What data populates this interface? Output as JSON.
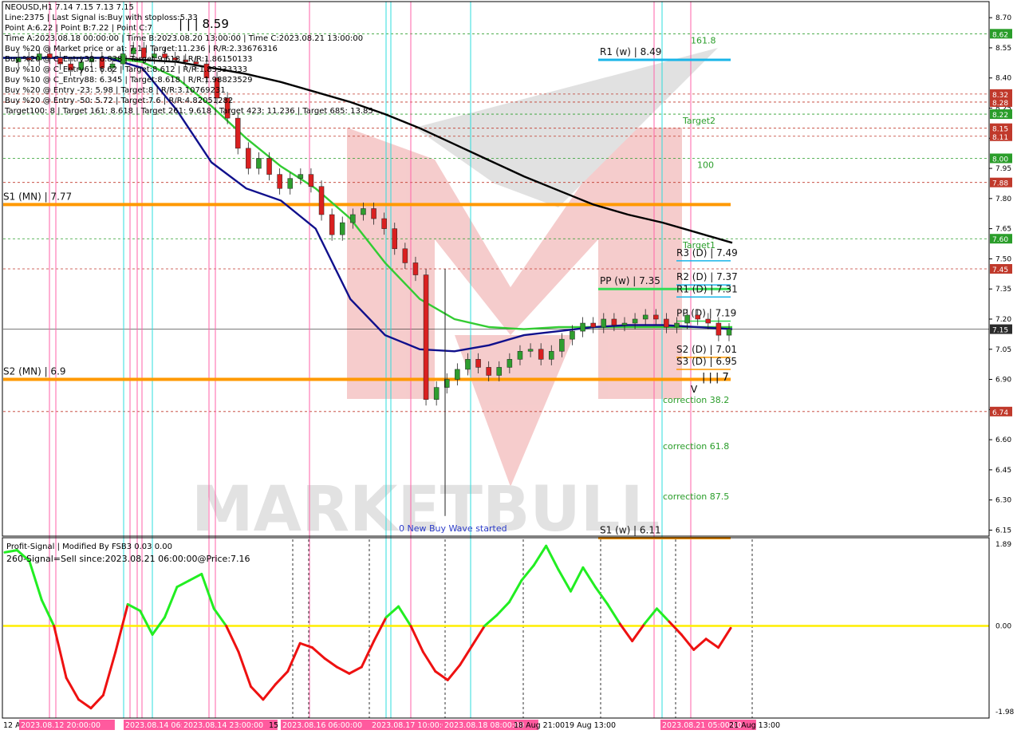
{
  "header": {
    "symbol_line": "NEOUSD,H1  7.14 7.15 7.13 7.15",
    "lines": [
      "Line:2375 | Last Signal is:Buy with stoploss:5.33",
      "Point A:6.22 | Point B:7.22 | Point C:7",
      "Time A:2023.08.18 00:00:00 | Time B:2023.08.20 13:00:00 | Time C:2023.08.21 13:00:00",
      "Buy %20 @ Market price or at: 7.1 | Target:11.236 | R/R:2.33676316",
      "Buy %20 @ C_Entry38: 6.838 | Target:9.618 | R/R:1.86150133",
      "Buy %10 @ C_Entry61: 6.62 | Target:8.612 | R/R:1.83333333",
      "Buy %10 @ C_Entry88: 6.345 | Target:8.618 | R/R:1.98823529",
      "Buy %20 @ Entry -23: 5.98 | Target:8 | R/R:3.10769231",
      "Buy %20 @ Entry -50: 5.72 | Target:7.6 | R/R:4.82051282",
      "Target100: 8 | Target 161: 8.618 | Target 261: 9.618 | Target 423: 11.236 | Target 685: 13.85"
    ],
    "wave_label": "| | | 8.59"
  },
  "chart_data": [
    {
      "type": "candlestick",
      "symbol": "NEOUSD",
      "timeframe": "H1",
      "ylim": [
        6.12,
        8.78
      ],
      "y_ticks": [
        "8.70",
        "8.55",
        "8.40",
        "8.25",
        "8.10",
        "7.95",
        "7.80",
        "7.65",
        "7.50",
        "7.35",
        "7.20",
        "7.05",
        "6.90",
        "6.75",
        "6.60",
        "6.45",
        "6.30",
        "6.15"
      ],
      "price_tags": [
        {
          "label": "8.62",
          "value": 8.62,
          "color": "#2a9d2a"
        },
        {
          "label": "8.32",
          "value": 8.32,
          "color": "#c0392b"
        },
        {
          "label": "8.28",
          "value": 8.28,
          "color": "#c0392b"
        },
        {
          "label": "8.22",
          "value": 8.22,
          "color": "#2a9d2a"
        },
        {
          "label": "8.15",
          "value": 8.15,
          "color": "#c0392b"
        },
        {
          "label": "8.11",
          "value": 8.11,
          "color": "#c0392b"
        },
        {
          "label": "8.00",
          "value": 8.0,
          "color": "#2a9d2a"
        },
        {
          "label": "7.88",
          "value": 7.88,
          "color": "#c0392b"
        },
        {
          "label": "7.60",
          "value": 7.6,
          "color": "#2a9d2a"
        },
        {
          "label": "7.45",
          "value": 7.45,
          "color": "#c0392b"
        },
        {
          "label": "7.15",
          "value": 7.15,
          "color": "#2b2b2b"
        },
        {
          "label": "6.74",
          "value": 6.74,
          "color": "#c0392b"
        }
      ],
      "levels": [
        {
          "label": "S1 (MN) | 7.77",
          "value": 7.77,
          "color": "#ff9900"
        },
        {
          "label": "S2 (MN) | 6.9",
          "value": 6.9,
          "color": "#ff9900"
        },
        {
          "label": "R1 (w) | 8.49",
          "value": 8.49,
          "color": "#19b5e8"
        },
        {
          "label": "PP (w) | 7.35",
          "value": 7.35,
          "color": "#33dd55"
        },
        {
          "label": "S1 (w) | 6.11",
          "value": 6.11,
          "color": "#ff9900"
        },
        {
          "label": "R3 (D) | 7.49",
          "value": 7.49,
          "color": "#19b5e8"
        },
        {
          "label": "R2 (D) | 7.37",
          "value": 7.37,
          "color": "#19b5e8"
        },
        {
          "label": "R1 (D) | 7.31",
          "value": 7.31,
          "color": "#19b5e8"
        },
        {
          "label": "PP (D) | 7.19",
          "value": 7.19,
          "color": "#33dd55"
        },
        {
          "label": "S2 (D) | 7.01",
          "value": 7.01,
          "color": "#ff9900"
        },
        {
          "label": "S3 (D) | 6.95",
          "value": 6.95,
          "color": "#ff9900"
        }
      ],
      "fib_labels": [
        {
          "label": "161.8",
          "value": 8.62,
          "color": "#2a9d2a"
        },
        {
          "label": "Target2",
          "value": 8.22,
          "color": "#2a9d2a"
        },
        {
          "label": "100",
          "value": 8.0,
          "color": "#2a9d2a"
        },
        {
          "label": "Target1",
          "value": 7.6,
          "color": "#2a9d2a"
        },
        {
          "label": "correction 38.2",
          "value": 6.83,
          "color": "#2a9d2a"
        },
        {
          "label": "correction 61.8",
          "value": 6.6,
          "color": "#2a9d2a"
        },
        {
          "label": "correction 87.5",
          "value": 6.35,
          "color": "#2a9d2a"
        }
      ],
      "annotations": [
        "0 New Buy Wave started",
        "| | | 7",
        "V"
      ],
      "moving_averages": [
        {
          "color": "#000000",
          "values": [
            8.5,
            8.5,
            8.5,
            8.5,
            8.49,
            8.48,
            8.45,
            8.42,
            8.38,
            8.33,
            8.28,
            8.22,
            8.15,
            8.07,
            7.99,
            7.91,
            7.84,
            7.77,
            7.72,
            7.68,
            7.63,
            7.58
          ]
        },
        {
          "color": "#33cc33",
          "values": [
            8.5,
            8.5,
            8.5,
            8.5,
            8.48,
            8.4,
            8.26,
            8.1,
            7.96,
            7.85,
            7.7,
            7.48,
            7.3,
            7.2,
            7.16,
            7.15,
            7.16,
            7.16,
            7.16,
            7.16,
            7.16,
            7.16
          ]
        },
        {
          "color": "#10108c",
          "values": [
            8.5,
            8.5,
            8.5,
            8.5,
            8.45,
            8.24,
            7.98,
            7.85,
            7.79,
            7.65,
            7.3,
            7.12,
            7.05,
            7.04,
            7.07,
            7.12,
            7.14,
            7.16,
            7.17,
            7.17,
            7.16,
            7.15
          ]
        }
      ],
      "price_path": [
        8.48,
        8.5,
        8.49,
        8.52,
        8.5,
        8.47,
        8.44,
        8.48,
        8.5,
        8.45,
        8.47,
        8.52,
        8.55,
        8.5,
        8.52,
        8.5,
        8.49,
        8.48,
        8.47,
        8.4,
        8.3,
        8.2,
        8.05,
        7.95,
        8.0,
        7.92,
        7.85,
        7.9,
        7.92,
        7.86,
        7.72,
        7.62,
        7.68,
        7.72,
        7.75,
        7.7,
        7.65,
        7.55,
        7.48,
        7.42,
        6.8,
        6.86,
        6.9,
        6.95,
        7.0,
        6.96,
        6.92,
        6.96,
        7.0,
        7.04,
        7.05,
        7.0,
        7.04,
        7.1,
        7.14,
        7.18,
        7.16,
        7.2,
        7.17,
        7.18,
        7.2,
        7.22,
        7.2,
        7.16,
        7.18,
        7.22,
        7.2,
        7.18,
        7.12,
        7.15
      ]
    },
    {
      "type": "line",
      "title": "Profit-Signal | Modified By FSB3 0.03 0.00",
      "subtitle": "260-Signal=Sell since:2023.08.21 06:00:00@Price:7.16",
      "ylim": [
        -1.98,
        1.89
      ],
      "y_ticks": [
        "1.89",
        "0.00",
        "-1.98"
      ],
      "values": [
        1.7,
        1.75,
        1.5,
        0.6,
        0.0,
        -1.2,
        -1.7,
        -1.9,
        -1.6,
        -0.6,
        0.5,
        0.35,
        -0.2,
        0.2,
        0.9,
        1.05,
        1.2,
        0.4,
        0.0,
        -0.6,
        -1.4,
        -1.7,
        -1.35,
        -1.05,
        -0.4,
        -0.5,
        -0.75,
        -0.95,
        -1.1,
        -0.95,
        -0.35,
        0.2,
        0.45,
        0.0,
        -0.6,
        -1.05,
        -1.25,
        -0.9,
        -0.45,
        0.0,
        0.25,
        0.55,
        1.05,
        1.4,
        1.85,
        1.3,
        0.8,
        1.35,
        0.9,
        0.5,
        0.05,
        -0.35,
        0.05,
        0.4,
        0.1,
        -0.2,
        -0.55,
        -0.3,
        -0.5,
        -0.05
      ]
    }
  ],
  "x_axis_labels": [
    {
      "label": "12 Aug 2023",
      "highlight": false
    },
    {
      "label": "2023.08.12 20:00:00",
      "highlight": true
    },
    {
      "label": "2023.08.14 06:00",
      "highlight": true
    },
    {
      "label": "2023.08.14 23:00:00",
      "highlight": true
    },
    {
      "label": "15 Aug",
      "highlight": false
    },
    {
      "label": "2023.08.16 06:00:00",
      "highlight": true
    },
    {
      "label": "2023.08.17 10:00:00",
      "highlight": true
    },
    {
      "label": "2023.08.18 08:00:00",
      "highlight": true
    },
    {
      "label": "18 Aug 21:00",
      "highlight": false
    },
    {
      "label": "19 Aug 13:00",
      "highlight": false
    },
    {
      "label": "2023.08.21 05:00:00",
      "highlight": true
    },
    {
      "label": "21 Aug 13:00",
      "highlight": false
    }
  ],
  "watermark": "MARKETBULL",
  "colors": {
    "up": "#2f9e2f",
    "down": "#d92020",
    "bg": "#ffffff",
    "watermark": "#f2b8b8"
  }
}
